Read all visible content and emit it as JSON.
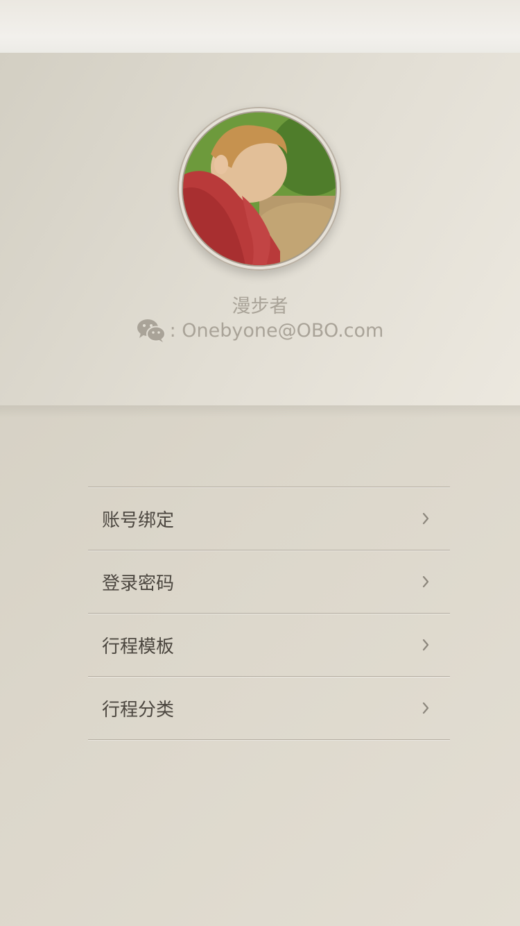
{
  "profile": {
    "username": "漫步者",
    "wechat_icon": "wechat-icon",
    "wechat_text": ": Onebyone@OBO.com"
  },
  "menu": {
    "items": [
      {
        "label": "账号绑定"
      },
      {
        "label": "登录密码"
      },
      {
        "label": "行程模板"
      },
      {
        "label": "行程分类"
      }
    ]
  },
  "colors": {
    "background": "#d8d3c8",
    "text_muted": "#a9a398",
    "text_menu": "#4c4740",
    "divider": "#b2ab9f"
  }
}
